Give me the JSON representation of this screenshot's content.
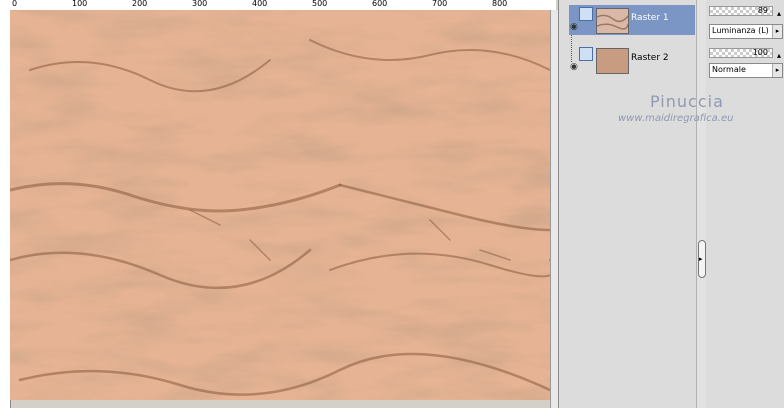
{
  "ruler": {
    "ticks": [
      "0",
      "100",
      "200",
      "300",
      "400",
      "500",
      "600",
      "700",
      "800"
    ]
  },
  "layers": [
    {
      "name": "Raster 1",
      "selected": true
    },
    {
      "name": "Raster 2",
      "selected": false
    }
  ],
  "properties": {
    "opacity": "89",
    "blend_mode": "Luminanza (L)",
    "opacity2": "100",
    "blend_mode2": "Normale"
  },
  "watermark": {
    "title": "Pinuccia",
    "url": "www.maidiregrafica.eu"
  },
  "colors": {
    "canvas_base": "#e6b394",
    "canvas_dark": "#8b5a3c",
    "selected_layer": "#7b96c4",
    "raster2_thumb": "#c89c80"
  }
}
